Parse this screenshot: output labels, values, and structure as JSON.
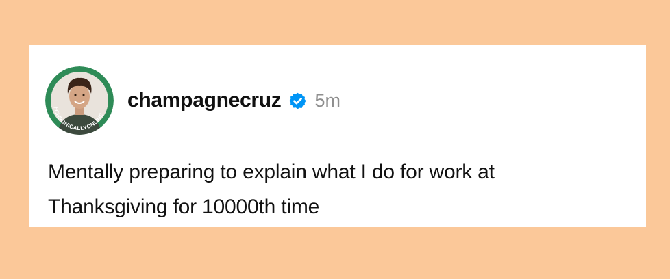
{
  "post": {
    "username": "champagnecruz",
    "timestamp": "5m",
    "avatar_badge_text": "#CHRONICALLYONLINE",
    "text_lines": [
      "Mentally preparing to explain what I do for work at",
      "Thanksgiving for 10000th time"
    ],
    "verified_icon": "verified-badge-icon"
  },
  "colors": {
    "background": "#fbc899",
    "card": "#ffffff",
    "verified": "#0095f6",
    "badge_ring": "#2e8b57",
    "timestamp": "#8e8e8e"
  }
}
